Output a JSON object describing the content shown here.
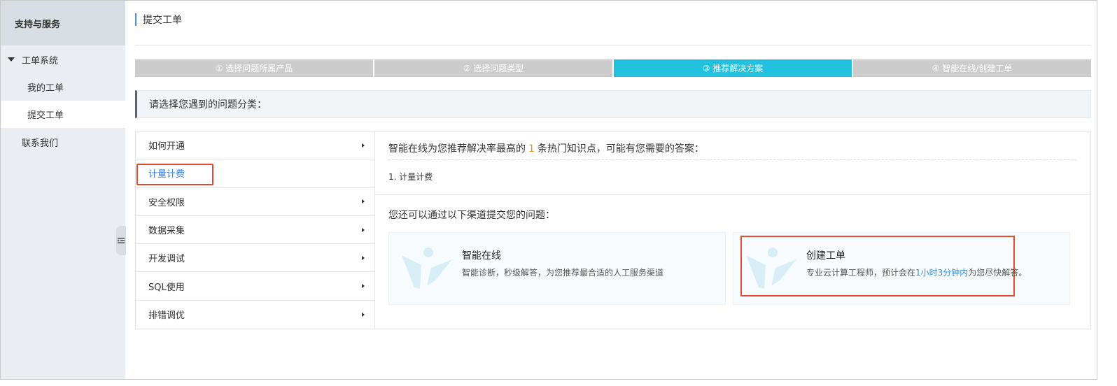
{
  "sidebar": {
    "header": "支持与服务",
    "group": "工单系统",
    "items": [
      "我的工单",
      "提交工单"
    ],
    "active_item": "提交工单",
    "contact": "联系我们"
  },
  "page": {
    "title": "提交工单"
  },
  "steps": [
    {
      "label": "① 选择问题所属产品",
      "active": false
    },
    {
      "label": "② 选择问题类型",
      "active": false
    },
    {
      "label": "③ 推荐解决方案",
      "active": true
    },
    {
      "label": "④ 智能在线/创建工单",
      "active": false
    }
  ],
  "prompt": "请选择您遇到的问题分类：",
  "categories": [
    {
      "label": "如何开通"
    },
    {
      "label": "计量计费",
      "active": true
    },
    {
      "label": "安全权限"
    },
    {
      "label": "数据采集"
    },
    {
      "label": "开发调试"
    },
    {
      "label": "SQL使用"
    },
    {
      "label": "排错调优"
    }
  ],
  "recommend": {
    "prefix": "智能在线为您推荐解决率最高的",
    "count": "1",
    "suffix": "条热门知识点，可能有您需要的答案：",
    "item": "1. 计量计费"
  },
  "channels": {
    "intro": "您还可以通过以下渠道提交您的问题：",
    "online": {
      "title": "智能在线",
      "desc": "智能诊断，秒级解答，为您推荐最合适的人工服务渠道"
    },
    "ticket": {
      "title": "创建工单",
      "desc_prefix": "专业云计算工程师，预计会在",
      "desc_link": "1小时3分钟内",
      "desc_suffix": "为您尽快解答。"
    }
  },
  "colors": {
    "accent": "#21c1df",
    "highlight_border": "#e14c2f",
    "link": "#2f90e0",
    "count": "#f08c1e"
  }
}
